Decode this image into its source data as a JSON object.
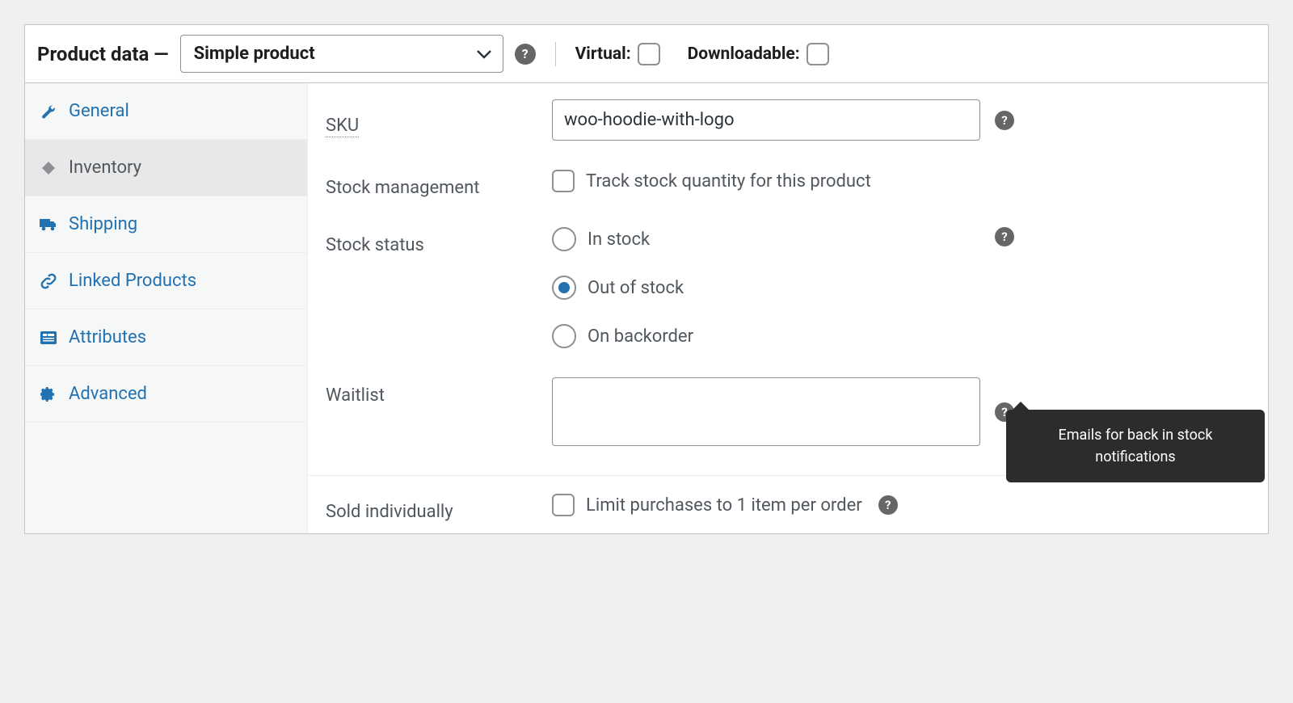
{
  "header": {
    "title": "Product data —",
    "product_type": "Simple product",
    "virtual_label": "Virtual:",
    "downloadable_label": "Downloadable:"
  },
  "sidebar": {
    "tabs": [
      {
        "label": "General"
      },
      {
        "label": "Inventory"
      },
      {
        "label": "Shipping"
      },
      {
        "label": "Linked Products"
      },
      {
        "label": "Attributes"
      },
      {
        "label": "Advanced"
      }
    ]
  },
  "form": {
    "sku": {
      "label": "SKU",
      "value": "woo-hoodie-with-logo"
    },
    "stock_management": {
      "label": "Stock management",
      "option": "Track stock quantity for this product"
    },
    "stock_status": {
      "label": "Stock status",
      "options": [
        "In stock",
        "Out of stock",
        "On backorder"
      ],
      "selected": 1
    },
    "waitlist": {
      "label": "Waitlist",
      "tooltip": "Emails for back in stock notifications"
    },
    "sold_individually": {
      "label": "Sold individually",
      "option": "Limit purchases to 1 item per order"
    }
  }
}
